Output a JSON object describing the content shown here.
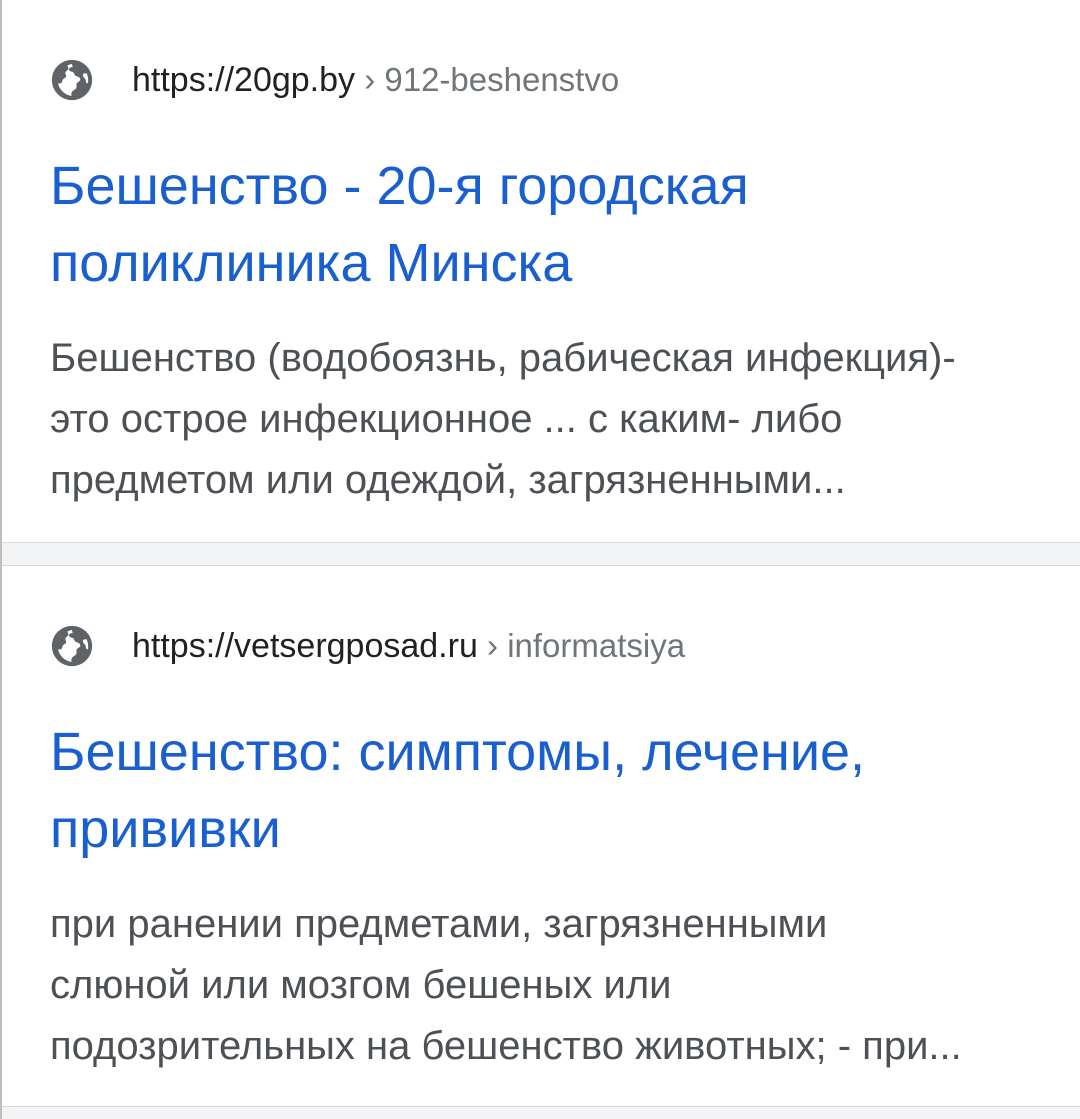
{
  "results": [
    {
      "url_domain": "https://20gp.by",
      "url_path": " › 912-beshenstvo",
      "title_line1": "Бешенство - 20-я городская",
      "title_line2": "поликлиника Минска",
      "snippet_line1": "Бешенство (водобоязнь, рабическая инфекция)-",
      "snippet_line2": "это острое инфекционное ... с каким- либо",
      "snippet_line3": "предметом или одеждой, загрязненными..."
    },
    {
      "url_domain": "https://vetsergposad.ru",
      "url_path": " › informatsiya",
      "title_line1": "Бешенство: симптомы, лечение,",
      "title_line2": "прививки",
      "snippet_line1": "при ранении предметами, загрязненными",
      "snippet_line2": "слюной или мозгом бешеных или",
      "snippet_line3": "подозрительных на бешенство животных; - при..."
    }
  ],
  "icons": {
    "favicon": "globe-icon"
  },
  "colors": {
    "title_link": "#1a5fcf",
    "url_domain": "#202124",
    "url_path": "#70757a",
    "snippet": "#4d5156",
    "globe": "#5f6368",
    "separator": "#f1f3f4"
  }
}
